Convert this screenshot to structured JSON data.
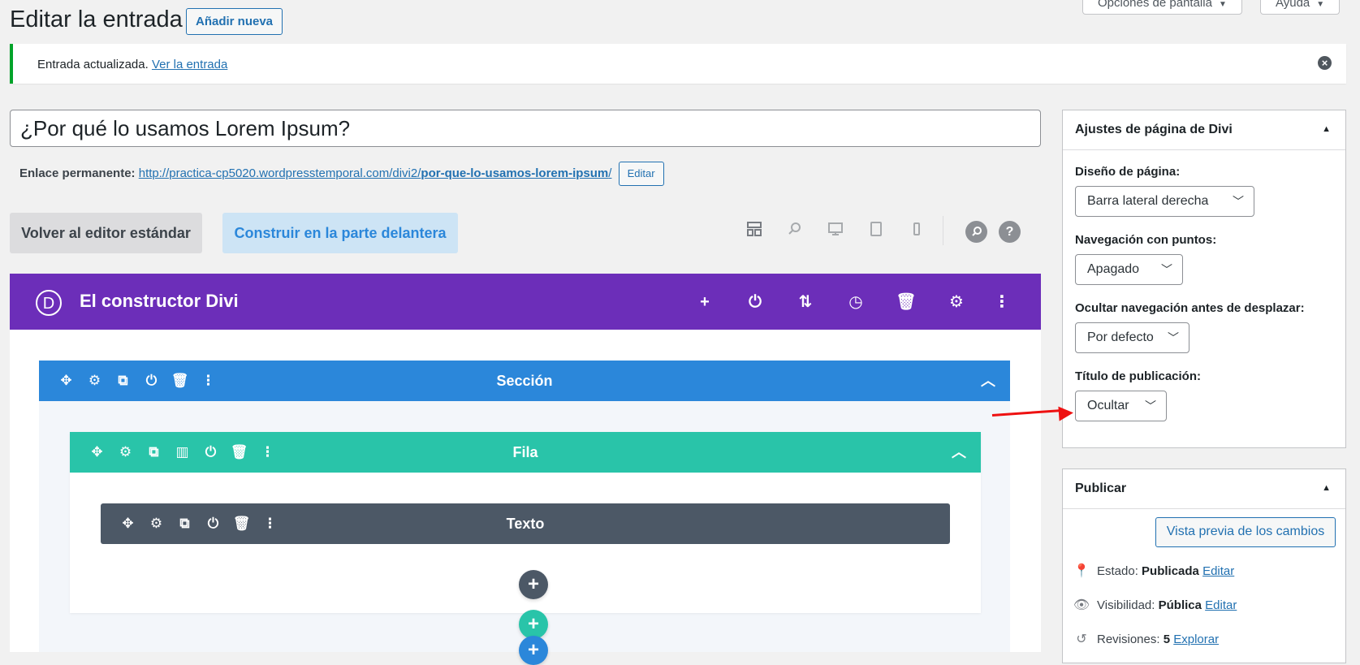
{
  "header": {
    "title": "Editar la entrada",
    "add_new": "Añadir nueva",
    "screen_options": "Opciones de pantalla",
    "help": "Ayuda"
  },
  "notice": {
    "text": "Entrada actualizada.",
    "link": "Ver la entrada"
  },
  "post": {
    "title": "¿Por qué lo usamos Lorem Ipsum?",
    "permalink_label": "Enlace permanente:",
    "permalink_base": "http://practica-cp5020.wordpresstemporal.com/divi2/",
    "permalink_slug": "por-que-lo-usamos-lorem-ipsum",
    "permalink_trail": "/",
    "permalink_edit": "Editar"
  },
  "builder_buttons": {
    "standard": "Volver al editor estándar",
    "frontend": "Construir en la parte delantera"
  },
  "toolbar_icons": [
    "layout-icon",
    "zoom-icon",
    "desktop-icon",
    "tablet-icon",
    "phone-icon",
    "search-icon",
    "help-icon"
  ],
  "divi": {
    "title": "El constructor Divi",
    "logo_letter": "D",
    "section_label": "Sección",
    "row_label": "Fila",
    "module_label": "Texto"
  },
  "colors": {
    "divi_purple": "#6c2eb9",
    "section_blue": "#2b87da",
    "row_green": "#29c4a9",
    "module_gray": "#4c5866",
    "wp_blue": "#2271b1"
  },
  "divi_settings": {
    "title": "Ajustes de página de Divi",
    "layout_label": "Diseño de página:",
    "layout_value": "Barra lateral derecha",
    "dots_label": "Navegación con puntos:",
    "dots_value": "Apagado",
    "hide_nav_label": "Ocultar navegación antes de desplazar:",
    "hide_nav_value": "Por defecto",
    "post_title_label": "Título de publicación:",
    "post_title_value": "Ocultar"
  },
  "publish": {
    "title": "Publicar",
    "preview": "Vista previa de los cambios",
    "status_label": "Estado:",
    "status_value": "Publicada",
    "status_edit": "Editar",
    "visibility_label": "Visibilidad:",
    "visibility_value": "Pública",
    "visibility_edit": "Editar",
    "revisions_label": "Revisiones:",
    "revisions_value": "5",
    "revisions_link": "Explorar"
  }
}
